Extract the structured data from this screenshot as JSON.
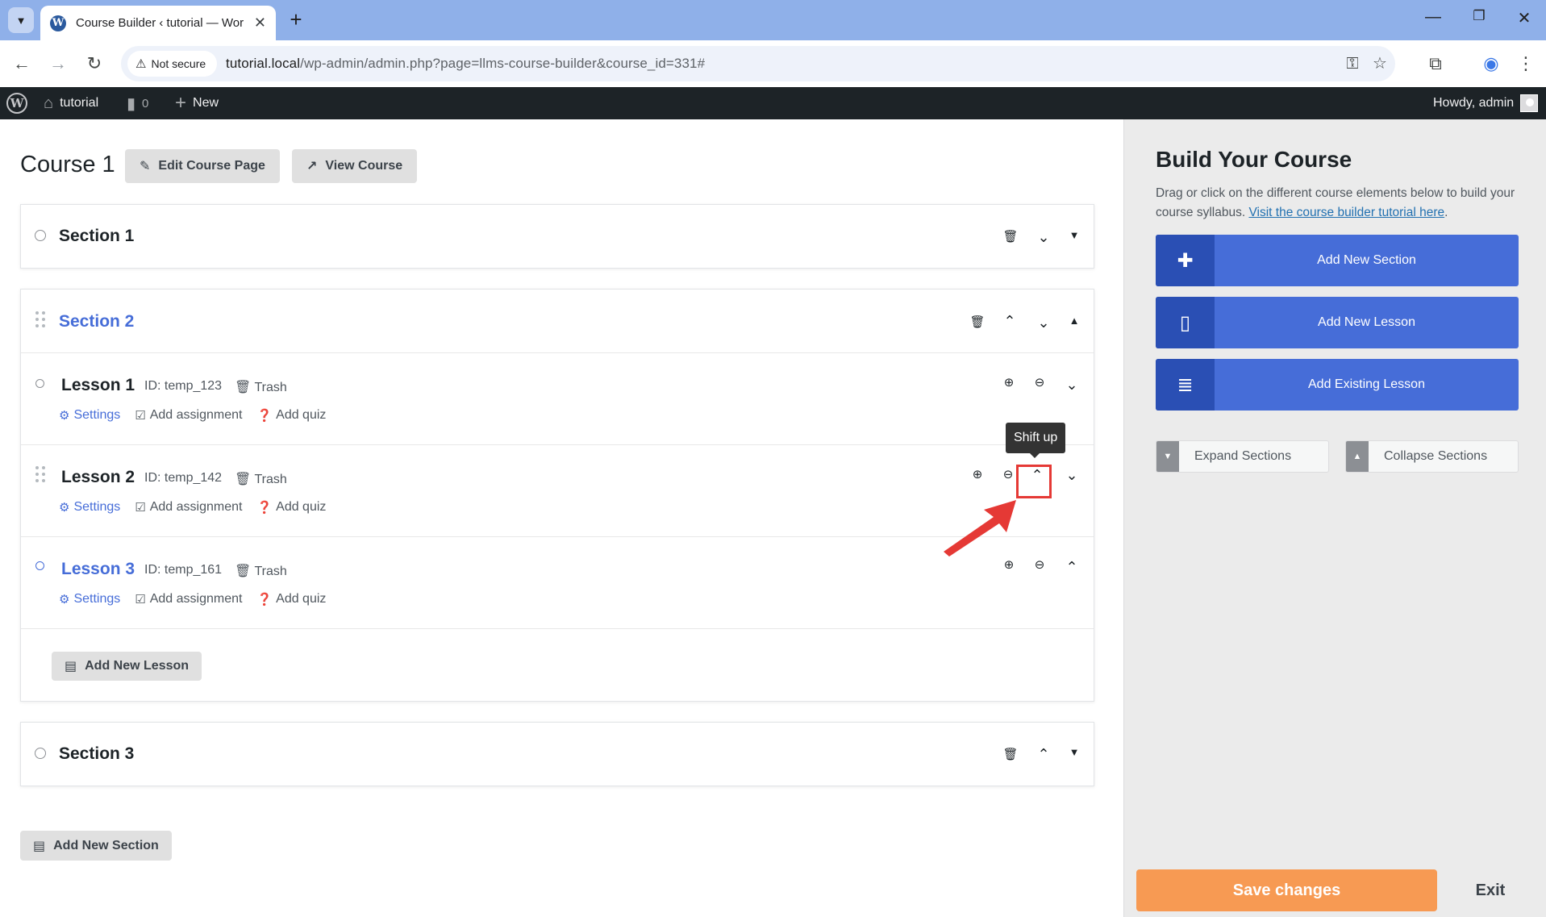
{
  "browser": {
    "tab_title": "Course Builder ‹ tutorial — Wor",
    "tab_favicon": "W",
    "new_tab_label": "+",
    "security_label": "Not secure",
    "url_host": "tutorial.local",
    "url_path": "/wp-admin/admin.php?page=llms-course-builder&course_id=331#"
  },
  "adminbar": {
    "site_name": "tutorial",
    "comments_count": "0",
    "new_label": "New",
    "greeting": "Howdy, admin"
  },
  "course": {
    "title": "Course 1",
    "edit_label": "Edit Course Page",
    "view_label": "View Course"
  },
  "sections": [
    {
      "title": "Section 1"
    },
    {
      "title": "Section 2",
      "lessons": [
        {
          "title": "Lesson 1",
          "id_text": "ID: temp_123",
          "trash": "Trash",
          "settings": "Settings",
          "add_assignment": "Add assignment",
          "add_quiz": "Add quiz"
        },
        {
          "title": "Lesson 2",
          "id_text": "ID: temp_142",
          "trash": "Trash",
          "settings": "Settings",
          "add_assignment": "Add assignment",
          "add_quiz": "Add quiz"
        },
        {
          "title": "Lesson 3",
          "id_text": "ID: temp_161",
          "trash": "Trash",
          "settings": "Settings",
          "add_assignment": "Add assignment",
          "add_quiz": "Add quiz"
        }
      ],
      "add_lesson_label": "Add New Lesson"
    },
    {
      "title": "Section 3"
    }
  ],
  "add_section_label": "Add New Section",
  "tooltip": "Shift up",
  "sidebar": {
    "title": "Build Your Course",
    "description": "Drag or click on the different course elements below to build your course syllabus.",
    "tutorial_link": "Visit the course builder tutorial here",
    "add_section": "Add New Section",
    "add_lesson": "Add New Lesson",
    "add_existing": "Add Existing Lesson",
    "expand": "Expand Sections",
    "collapse": "Collapse Sections",
    "save": "Save changes",
    "exit": "Exit"
  },
  "colors": {
    "primary": "#466dd8",
    "primary_dark": "#2a4fb4",
    "save": "#f79a53",
    "highlight": "#e53935"
  }
}
